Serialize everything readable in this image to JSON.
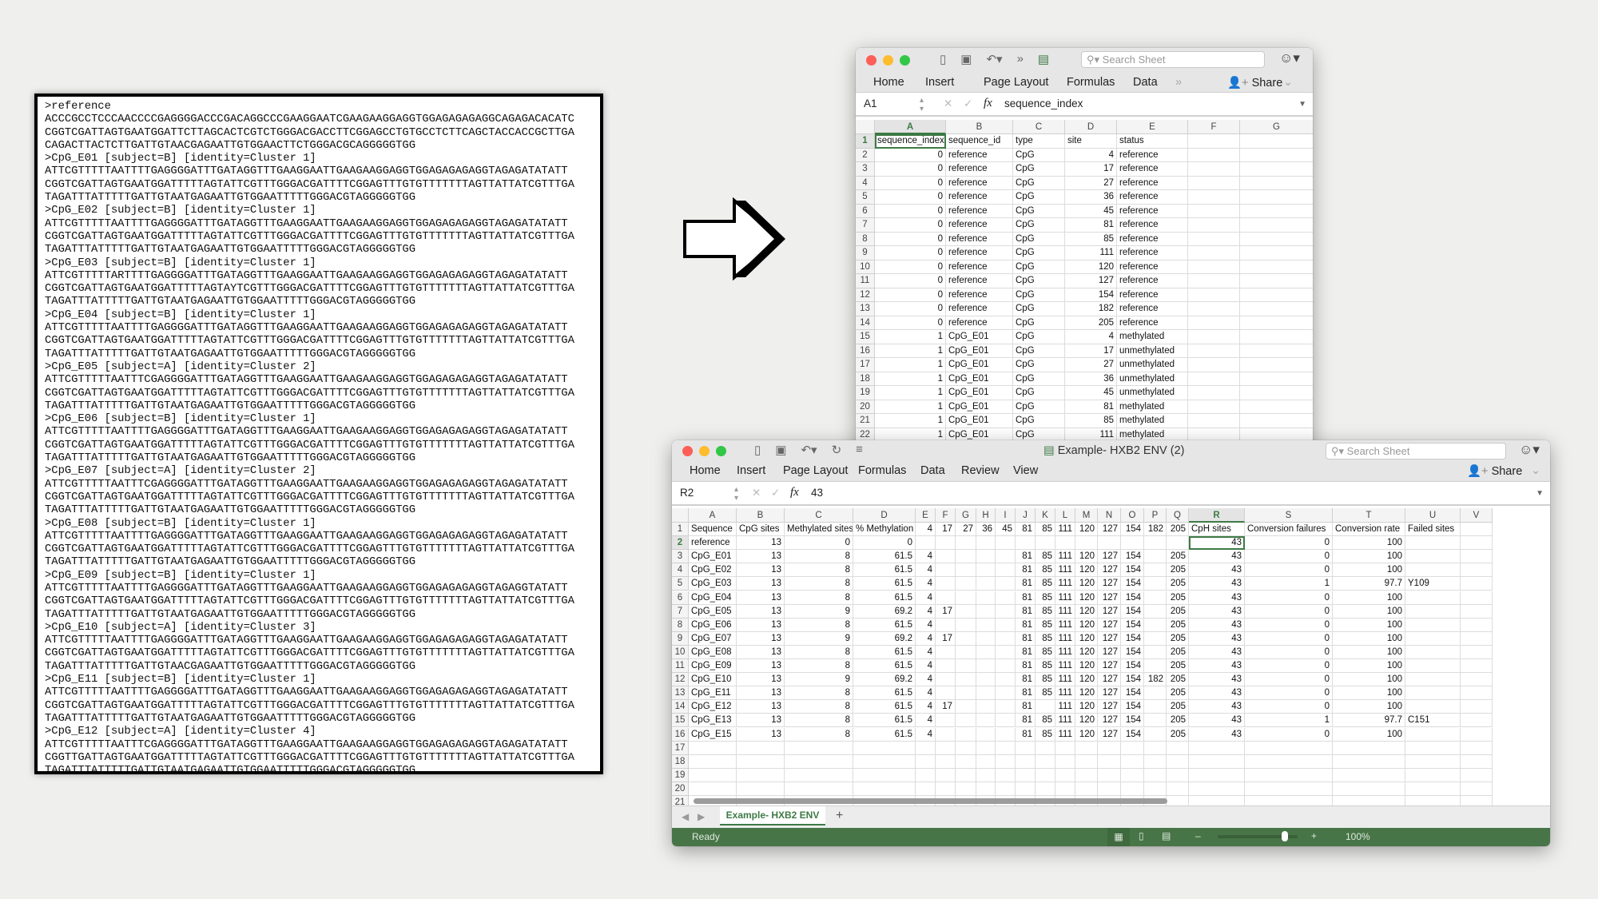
{
  "fasta": {
    "lines": [
      ">reference",
      "ACCCGCCTCCCAACCCCGAGGGGACCCGACAGGCCCGAAGGAATCGAAGAAGGAGGTGGAGAGAGAGGCAGAGACACATC",
      "CGGTCGATTAGTGAATGGATTCTTAGCACTCGTCTGGGACGACCTTCGGAGCCTGTGCCTCTTCAGCTACCACCGCTTGA",
      "CAGACTTACTCTTGATTGTAACGAGAATTGTGGAACTTCTGGGACGCAGGGGGTGG",
      ">CpG_E01 [subject=B] [identity=Cluster 1]",
      "ATTCGTTTTTAATTTTGAGGGGATTTGATAGGTTTGAAGGAATTGAAGAAGGAGGTGGAGAGAGAGGTAGAGATATATT",
      "CGGTCGATTAGTGAATGGATTTTTAGTATTCGTTTGGGACGATTTTCGGAGTTTGTGTTTTTTTAGTTATTATCGTTTGA",
      "TAGATTTATTTTTGATTGTAATGAGAATTGTGGAATTTTTGGGACGTAGGGGGTGG",
      ">CpG_E02 [subject=B] [identity=Cluster 1]",
      "ATTCGTTTTTAATTTTGAGGGGATTTGATAGGTTTGAAGGAATTGAAGAAGGAGGTGGAGAGAGAGGTAGAGATATATT",
      "CGGTCGATTAGTGAATGGATTTTTAGTATTCGTTTGGGACGATTTTCGGAGTTTGTGTTTTTTTAGTTATTATCGTTTGA",
      "TAGATTTATTTTTGATTGTAATGAGAATTGTGGAATTTTTGGGACGTAGGGGGTGG",
      ">CpG_E03 [subject=B] [identity=Cluster 1]",
      "ATTCGTTTTTARTTTTGAGGGGATTTGATAGGTTTGAAGGAATTGAAGAAGGAGGTGGAGAGAGAGGTAGAGATATATT",
      "CGGTCGATTAGTGAATGGATTTTTAGTAYTCGTTTGGGACGATTTTCGGAGTTTGTGTTTTTTTAGTTATTATCGTTTGA",
      "TAGATTTATTTTTGATTGTAATGAGAATTGTGGAATTTTTGGGACGTAGGGGGTGG",
      ">CpG_E04 [subject=B] [identity=Cluster 1]",
      "ATTCGTTTTTAATTTTGAGGGGATTTGATAGGTTTGAAGGAATTGAAGAAGGAGGTGGAGAGAGAGGTAGAGATATATT",
      "CGGTCGATTAGTGAATGGATTTTTAGTATTCGTTTGGGACGATTTTCGGAGTTTGTGTTTTTTTAGTTATTATCGTTTGA",
      "TAGATTTATTTTTGATTGTAATGAGAATTGTGGAATTTTTGGGACGTAGGGGGTGG",
      ">CpG_E05 [subject=A] [identity=Cluster 2]",
      "ATTCGTTTTTAATTTCGAGGGGATTTGATAGGTTTGAAGGAATTGAAGAAGGAGGTGGAGAGAGAGGTAGAGATATATT",
      "CGGTCGATTAGTGAATGGATTTTTAGTATTCGTTTGGGACGATTTTCGGAGTTTGTGTTTTTTTAGTTATTATCGTTTGA",
      "TAGATTTATTTTTGATTGTAATGAGAATTGTGGAATTTTTGGGACGTAGGGGGTGG",
      ">CpG_E06 [subject=B] [identity=Cluster 1]",
      "ATTCGTTTTTAATTTTGAGGGGATTTGATAGGTTTGAAGGAATTGAAGAAGGAGGTGGAGAGAGAGGTAGAGATATATT",
      "CGGTCGATTAGTGAATGGATTTTTAGTATTCGTTTGGGACGATTTTCGGAGTTTGTGTTTTTTTAGTTATTATCGTTTGA",
      "TAGATTTATTTTTGATTGTAATGAGAATTGTGGAATTTTTGGGACGTAGGGGGTGG",
      ">CpG_E07 [subject=A] [identity=Cluster 2]",
      "ATTCGTTTTTAATTTCGAGGGGATTTGATAGGTTTGAAGGAATTGAAGAAGGAGGTGGAGAGAGAGGTAGAGATATATT",
      "CGGTCGATTAGTGAATGGATTTTTAGTATTCGTTTGGGACGATTTTCGGAGTTTGTGTTTTTTTAGTTATTATCGTTTGA",
      "TAGATTTATTTTTGATTGTAATGAGAATTGTGGAATTTTTGGGACGTAGGGGGTGG",
      ">CpG_E08 [subject=B] [identity=Cluster 1]",
      "ATTCGTTTTTAATTTTGAGGGGATTTGATAGGTTTGAAGGAATTGAAGAAGGAGGTGGAGAGAGAGGTAGAGATATATT",
      "CGGTCGATTAGTGAATGGATTTTTAGTATTCGTTTGGGACGATTTTCGGAGTTTGTGTTTTTTTAGTTATTATCGTTTGA",
      "TAGATTTATTTTTGATTGTAATGAGAATTGTGGAATTTTTGGGACGTAGGGGGTGG",
      ">CpG_E09 [subject=B] [identity=Cluster 1]",
      "ATTCGTTTTTAATTTTGAGGGGATTTGATAGGTTTGAAGGAATTGAAGAAGGAGGTGGAGAGAGAGGTAGAGGTATATT",
      "CGGTCGATTAGTGAATGGATTTTTAGTATTCGTTTGGGACGATTTTCGGAGTTTGTGTTTTTTTAGTTATTATCGTTTGA",
      "TAGATTTATTTTTGATTGTAATGAGAATTGTGGAATTTTTGGGACGTAGGGGGTGG",
      ">CpG_E10 [subject=A] [identity=Cluster 3]",
      "ATTCGTTTTTAATTTTGAGGGGATTTGATAGGTTTGAAGGAATTGAAGAAGGAGGTGGAGAGAGAGGTAGAGATATATT",
      "CGGTCGATTAGTGAATGGATTTTTAGTATTCGTTTGGGACGATTTTCGGAGTTTGTGTTTTTTTAGTTATTATCGTTTGA",
      "TAGATTTATTTTTGATTGTAACGAGAATTGTGGAATTTTTGGGACGTAGGGGGTGG",
      ">CpG_E11 [subject=B] [identity=Cluster 1]",
      "ATTCGTTTTTAATTTTGAGGGGATTTGATAGGTTTGAAGGAATTGAAGAAGGAGGTGGAGAGAGAGGTAGAGATATATT",
      "CGGTCGATTAGTGAATGGATTTTTAGTATTCGTTTGGGACGATTTTCGGAGTTTGTGTTTTTTTAGTTATTATCGTTTGA",
      "TAGATTTATTTTTGATTGTAATGAGAATTGTGGAATTTTTGGGACGTAGGGGGTGG",
      ">CpG_E12 [subject=A] [identity=Cluster 4]",
      "ATTCGTTTTTAATTTCGAGGGGATTTGATAGGTTTGAAGGAATTGAAGAAGGAGGTGGAGAGAGAGGTAGAGATATATT",
      "CGGTTGATTAGTGAATGGATTTTTAGTATTCGTTTGGGACGATTTTCGGAGTTTGTGTTTTTTTAGTTATTATCGTTTGA",
      "TAGATTTATTTTTGATTGTAATGAGAATTGTGGAATTTTTGGGACGTAGGGGGTGG"
    ]
  },
  "top_window": {
    "search_placeholder": "Search Sheet",
    "tabs": [
      "Home",
      "Insert",
      "Page Layout",
      "Formulas",
      "Data"
    ],
    "more_tabs": "»",
    "share_label": "Share",
    "name_box": "A1",
    "formula": "sequence_index",
    "selected_cell": "A1",
    "columns": [
      "A",
      "B",
      "C",
      "D",
      "E",
      "F",
      "G"
    ],
    "rows": [
      [
        "sequence_index",
        "sequence_id",
        "type",
        "site",
        "status",
        "",
        ""
      ],
      [
        "0",
        "reference",
        "CpG",
        "4",
        "reference",
        "",
        ""
      ],
      [
        "0",
        "reference",
        "CpG",
        "17",
        "reference",
        "",
        ""
      ],
      [
        "0",
        "reference",
        "CpG",
        "27",
        "reference",
        "",
        ""
      ],
      [
        "0",
        "reference",
        "CpG",
        "36",
        "reference",
        "",
        ""
      ],
      [
        "0",
        "reference",
        "CpG",
        "45",
        "reference",
        "",
        ""
      ],
      [
        "0",
        "reference",
        "CpG",
        "81",
        "reference",
        "",
        ""
      ],
      [
        "0",
        "reference",
        "CpG",
        "85",
        "reference",
        "",
        ""
      ],
      [
        "0",
        "reference",
        "CpG",
        "111",
        "reference",
        "",
        ""
      ],
      [
        "0",
        "reference",
        "CpG",
        "120",
        "reference",
        "",
        ""
      ],
      [
        "0",
        "reference",
        "CpG",
        "127",
        "reference",
        "",
        ""
      ],
      [
        "0",
        "reference",
        "CpG",
        "154",
        "reference",
        "",
        ""
      ],
      [
        "0",
        "reference",
        "CpG",
        "182",
        "reference",
        "",
        ""
      ],
      [
        "0",
        "reference",
        "CpG",
        "205",
        "reference",
        "",
        ""
      ],
      [
        "1",
        "CpG_E01",
        "CpG",
        "4",
        "methylated",
        "",
        ""
      ],
      [
        "1",
        "CpG_E01",
        "CpG",
        "17",
        "unmethylated",
        "",
        ""
      ],
      [
        "1",
        "CpG_E01",
        "CpG",
        "27",
        "unmethylated",
        "",
        ""
      ],
      [
        "1",
        "CpG_E01",
        "CpG",
        "36",
        "unmethylated",
        "",
        ""
      ],
      [
        "1",
        "CpG_E01",
        "CpG",
        "45",
        "unmethylated",
        "",
        ""
      ],
      [
        "1",
        "CpG_E01",
        "CpG",
        "81",
        "methylated",
        "",
        ""
      ],
      [
        "1",
        "CpG_E01",
        "CpG",
        "85",
        "methylated",
        "",
        ""
      ],
      [
        "1",
        "CpG_E01",
        "CpG",
        "111",
        "methylated",
        "",
        ""
      ]
    ]
  },
  "bottom_window": {
    "title": "Example- HXB2 ENV (2)",
    "search_placeholder": "Search Sheet",
    "tabs": [
      "Home",
      "Insert",
      "Page Layout",
      "Formulas",
      "Data",
      "Review",
      "View"
    ],
    "share_label": "Share",
    "name_box": "R2",
    "formula": "43",
    "selected_cell": "R2",
    "columns": [
      "A",
      "B",
      "C",
      "D",
      "E",
      "F",
      "G",
      "H",
      "I",
      "J",
      "K",
      "L",
      "M",
      "N",
      "O",
      "P",
      "Q",
      "R",
      "S",
      "T",
      "U",
      "V"
    ],
    "rows": [
      [
        "Sequence",
        "CpG sites",
        "Methylated sites",
        "% Methylation",
        "4",
        "17",
        "27",
        "36",
        "45",
        "81",
        "85",
        "111",
        "120",
        "127",
        "154",
        "182",
        "205",
        "CpH sites",
        "Conversion failures",
        "Conversion rate",
        "Failed sites",
        ""
      ],
      [
        "reference",
        "13",
        "0",
        "0",
        "",
        "",
        "",
        "",
        "",
        "",
        "",
        "",
        "",
        "",
        "",
        "",
        "",
        "43",
        "0",
        "100",
        "",
        ""
      ],
      [
        "CpG_E01",
        "13",
        "8",
        "61.5",
        "4",
        "",
        "",
        "",
        "",
        "81",
        "85",
        "111",
        "120",
        "127",
        "154",
        "",
        "205",
        "43",
        "0",
        "100",
        "",
        ""
      ],
      [
        "CpG_E02",
        "13",
        "8",
        "61.5",
        "4",
        "",
        "",
        "",
        "",
        "81",
        "85",
        "111",
        "120",
        "127",
        "154",
        "",
        "205",
        "43",
        "0",
        "100",
        "",
        ""
      ],
      [
        "CpG_E03",
        "13",
        "8",
        "61.5",
        "4",
        "",
        "",
        "",
        "",
        "81",
        "85",
        "111",
        "120",
        "127",
        "154",
        "",
        "205",
        "43",
        "1",
        "97.7",
        "Y109",
        ""
      ],
      [
        "CpG_E04",
        "13",
        "8",
        "61.5",
        "4",
        "",
        "",
        "",
        "",
        "81",
        "85",
        "111",
        "120",
        "127",
        "154",
        "",
        "205",
        "43",
        "0",
        "100",
        "",
        ""
      ],
      [
        "CpG_E05",
        "13",
        "9",
        "69.2",
        "4",
        "17",
        "",
        "",
        "",
        "81",
        "85",
        "111",
        "120",
        "127",
        "154",
        "",
        "205",
        "43",
        "0",
        "100",
        "",
        ""
      ],
      [
        "CpG_E06",
        "13",
        "8",
        "61.5",
        "4",
        "",
        "",
        "",
        "",
        "81",
        "85",
        "111",
        "120",
        "127",
        "154",
        "",
        "205",
        "43",
        "0",
        "100",
        "",
        ""
      ],
      [
        "CpG_E07",
        "13",
        "9",
        "69.2",
        "4",
        "17",
        "",
        "",
        "",
        "81",
        "85",
        "111",
        "120",
        "127",
        "154",
        "",
        "205",
        "43",
        "0",
        "100",
        "",
        ""
      ],
      [
        "CpG_E08",
        "13",
        "8",
        "61.5",
        "4",
        "",
        "",
        "",
        "",
        "81",
        "85",
        "111",
        "120",
        "127",
        "154",
        "",
        "205",
        "43",
        "0",
        "100",
        "",
        ""
      ],
      [
        "CpG_E09",
        "13",
        "8",
        "61.5",
        "4",
        "",
        "",
        "",
        "",
        "81",
        "85",
        "111",
        "120",
        "127",
        "154",
        "",
        "205",
        "43",
        "0",
        "100",
        "",
        ""
      ],
      [
        "CpG_E10",
        "13",
        "9",
        "69.2",
        "4",
        "",
        "",
        "",
        "",
        "81",
        "85",
        "111",
        "120",
        "127",
        "154",
        "182",
        "205",
        "43",
        "0",
        "100",
        "",
        ""
      ],
      [
        "CpG_E11",
        "13",
        "8",
        "61.5",
        "4",
        "",
        "",
        "",
        "",
        "81",
        "85",
        "111",
        "120",
        "127",
        "154",
        "",
        "205",
        "43",
        "0",
        "100",
        "",
        ""
      ],
      [
        "CpG_E12",
        "13",
        "8",
        "61.5",
        "4",
        "17",
        "",
        "",
        "",
        "81",
        "",
        "111",
        "120",
        "127",
        "154",
        "",
        "205",
        "43",
        "0",
        "100",
        "",
        ""
      ],
      [
        "CpG_E13",
        "13",
        "8",
        "61.5",
        "4",
        "",
        "",
        "",
        "",
        "81",
        "85",
        "111",
        "120",
        "127",
        "154",
        "",
        "205",
        "43",
        "1",
        "97.7",
        "C151",
        ""
      ],
      [
        "CpG_E15",
        "13",
        "8",
        "61.5",
        "4",
        "",
        "",
        "",
        "",
        "81",
        "85",
        "111",
        "120",
        "127",
        "154",
        "",
        "205",
        "43",
        "0",
        "100",
        "",
        ""
      ],
      [
        "",
        "",
        "",
        "",
        "",
        "",
        "",
        "",
        "",
        "",
        "",
        "",
        "",
        "",
        "",
        "",
        "",
        "",
        "",
        "",
        "",
        ""
      ],
      [
        "",
        "",
        "",
        "",
        "",
        "",
        "",
        "",
        "",
        "",
        "",
        "",
        "",
        "",
        "",
        "",
        "",
        "",
        "",
        "",
        "",
        ""
      ],
      [
        "",
        "",
        "",
        "",
        "",
        "",
        "",
        "",
        "",
        "",
        "",
        "",
        "",
        "",
        "",
        "",
        "",
        "",
        "",
        "",
        "",
        ""
      ],
      [
        "",
        "",
        "",
        "",
        "",
        "",
        "",
        "",
        "",
        "",
        "",
        "",
        "",
        "",
        "",
        "",
        "",
        "",
        "",
        "",
        "",
        ""
      ],
      [
        "",
        "",
        "",
        "",
        "",
        "",
        "",
        "",
        "",
        "",
        "",
        "",
        "",
        "",
        "",
        "",
        "",
        "",
        "",
        "",
        "",
        ""
      ]
    ],
    "sheet_tab": "Example- HXB2 ENV (2)",
    "status": "Ready",
    "zoom": "100%",
    "zoom_level_percent": 100
  },
  "colors": {
    "excel_green": "#477547",
    "selection": "#3d7a45",
    "close": "#fc5f57",
    "minimize": "#fdbc2e",
    "maximize": "#33c748"
  }
}
